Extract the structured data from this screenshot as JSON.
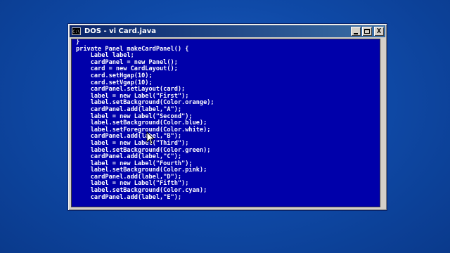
{
  "window": {
    "title": "DOS - vi Card.java",
    "icon": "console-icon",
    "buttons": {
      "minimize": "_",
      "maximize": "□",
      "close": "X"
    }
  },
  "editor": {
    "background": "#0000aa",
    "foreground": "#ffffff",
    "lines": [
      "}",
      "private Panel makeCardPanel() {",
      "    Label label;",
      "    cardPanel = new Panel();",
      "    card = new CardLayout();",
      "    card.setHgap(10);",
      "    card.setVgap(10);",
      "    cardPanel.setLayout(card);",
      "    label = new Label(\"First\");",
      "    label.setBackground(Color.orange);",
      "    cardPanel.add(label,\"A\");",
      "    label = new Label(\"Second\");",
      "    label.setBackground(Color.blue);",
      "    label.setForeground(Color.white);",
      "    cardPanel.add(label,\"B\");",
      "    label = new Label(\"Third\");",
      "    label.setBackground(Color.green);",
      "    cardPanel.add(label,\"C\");",
      "    label = new Label(\"Fourth\");",
      "    label.setBackground(Color.pink);",
      "    cardPanel.add(label,\"D\");",
      "    label = new Label(\"Fifth\");",
      "    label.setBackground(Color.cyan);",
      "    cardPanel.add(label,\"E\");"
    ]
  },
  "colors": {
    "desktop": "#0f4aa8",
    "titlebar_start": "#0a246a",
    "titlebar_end": "#3a6ea5",
    "window_frame": "#d4d0c8"
  }
}
